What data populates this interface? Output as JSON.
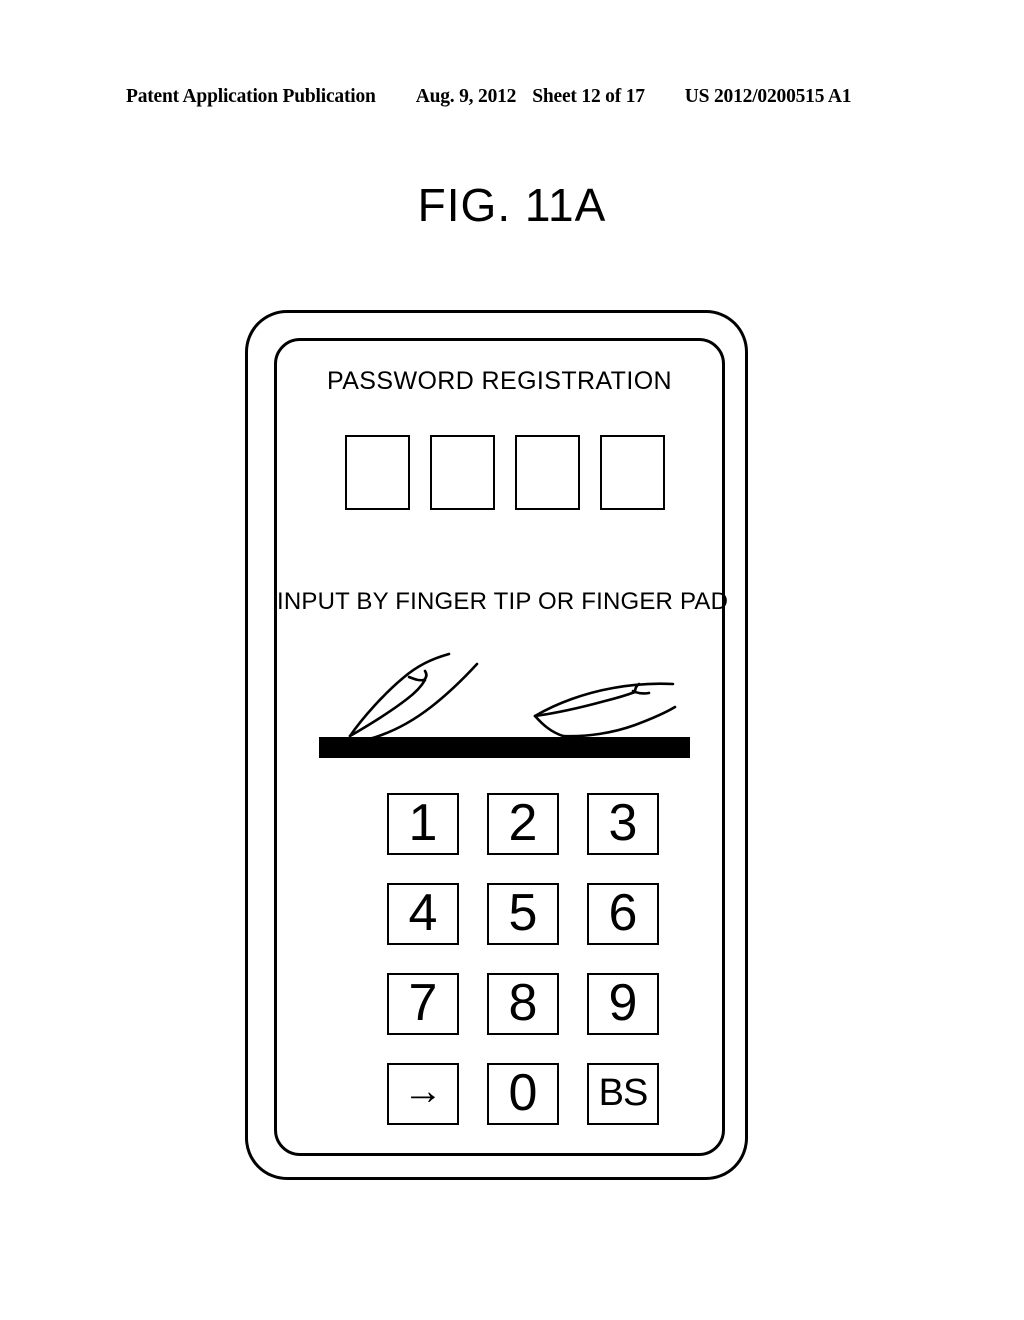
{
  "patent_header": {
    "publication": "Patent Application Publication",
    "date": "Aug. 9, 2012",
    "sheet": "Sheet 12 of 17",
    "number": "US 2012/0200515 A1"
  },
  "figure": {
    "title": "FIG. 11A"
  },
  "device": {
    "screen": {
      "title": "PASSWORD REGISTRATION",
      "password_boxes": [
        {
          "value": ""
        },
        {
          "value": ""
        },
        {
          "value": ""
        },
        {
          "value": ""
        }
      ],
      "instruction": "INPUT BY FINGER TIP OR FINGER PAD",
      "illustration": {
        "name": "finger-tip-and-finger-pad-on-sensor-bar",
        "left_finger_label": "finger-tip",
        "right_finger_label": "finger-pad",
        "sensor_bar_color": "#000000"
      },
      "keypad": {
        "keys": [
          {
            "label": "1",
            "name": "key-1"
          },
          {
            "label": "2",
            "name": "key-2"
          },
          {
            "label": "3",
            "name": "key-3"
          },
          {
            "label": "4",
            "name": "key-4"
          },
          {
            "label": "5",
            "name": "key-5"
          },
          {
            "label": "6",
            "name": "key-6"
          },
          {
            "label": "7",
            "name": "key-7"
          },
          {
            "label": "8",
            "name": "key-8"
          },
          {
            "label": "9",
            "name": "key-9"
          },
          {
            "label": "→",
            "name": "key-enter-arrow"
          },
          {
            "label": "0",
            "name": "key-0"
          },
          {
            "label": "BS",
            "name": "key-backspace"
          }
        ]
      }
    }
  },
  "colors": {
    "ink": "#000000",
    "page": "#ffffff"
  }
}
